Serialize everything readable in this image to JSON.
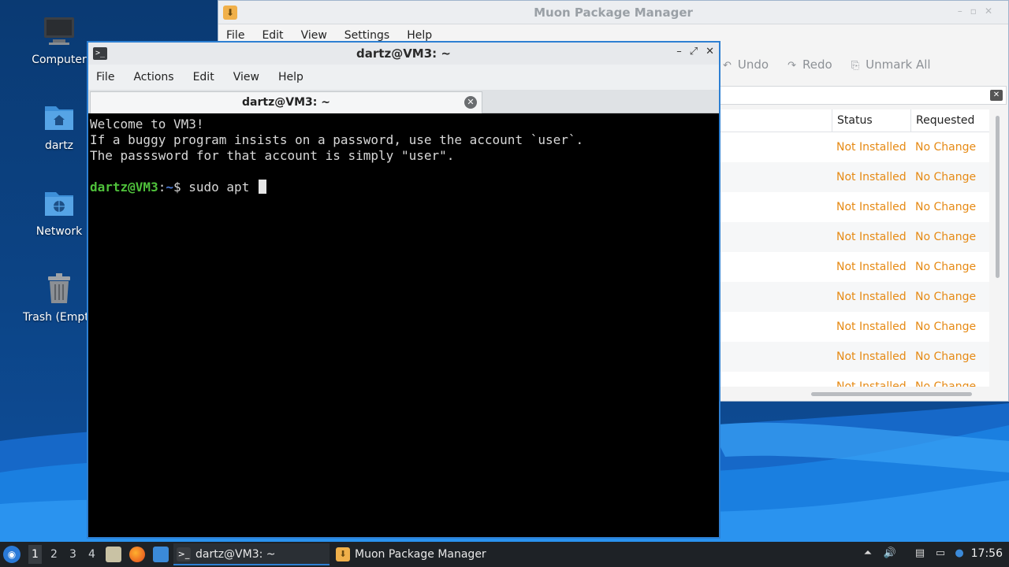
{
  "desktop": {
    "icons": [
      {
        "label": "Computer",
        "icon": "computer-icon"
      },
      {
        "label": "dartz",
        "icon": "home-folder-icon"
      },
      {
        "label": "Network",
        "icon": "network-folder-icon"
      },
      {
        "label": "Trash (Empty)",
        "icon": "trash-icon"
      }
    ]
  },
  "muon": {
    "title": "Muon Package Manager",
    "menu": [
      "File",
      "Edit",
      "View",
      "Settings",
      "Help"
    ],
    "toolbar": {
      "undo": "Undo",
      "redo": "Redo",
      "unmark_all": "Unmark All"
    },
    "columns": {
      "status": "Status",
      "requested": "Requested"
    },
    "rows": [
      {
        "status": "Not Installed",
        "requested": "No Change"
      },
      {
        "status": "Not Installed",
        "requested": "No Change"
      },
      {
        "status": "Not Installed",
        "requested": "No Change"
      },
      {
        "status": "Not Installed",
        "requested": "No Change"
      },
      {
        "status": "Not Installed",
        "requested": "No Change"
      },
      {
        "status": "Not Installed",
        "requested": "No Change"
      },
      {
        "status": "Not Installed",
        "requested": "No Change"
      },
      {
        "status": "Not Installed",
        "requested": "No Change"
      },
      {
        "status": "Not Installed",
        "requested": "No Change"
      }
    ],
    "status_color": "#e68a14"
  },
  "terminal": {
    "title": "dartz@VM3: ~",
    "menu": [
      "File",
      "Actions",
      "Edit",
      "View",
      "Help"
    ],
    "tab_label": "dartz@VM3: ~",
    "lines": [
      "Welcome to VM3!",
      "If a buggy program insists on a password, use the account `user`.",
      "The passsword for that account is simply \"user\"."
    ],
    "prompt": {
      "user_host": "dartz@VM3",
      "sep": ":",
      "path": "~",
      "symbol": "$",
      "command": " sudo apt "
    }
  },
  "taskbar": {
    "workspaces": [
      "1",
      "2",
      "3",
      "4"
    ],
    "tasks": [
      {
        "label": "dartz@VM3: ~",
        "icon": "terminal-icon",
        "active": true
      },
      {
        "label": "Muon Package Manager",
        "icon": "muon-icon",
        "active": false
      }
    ],
    "clock": "17:56"
  },
  "colors": {
    "accent": "#2d7fd2",
    "prompt_user": "#4fc13b",
    "prompt_path": "#4b7ad6"
  }
}
